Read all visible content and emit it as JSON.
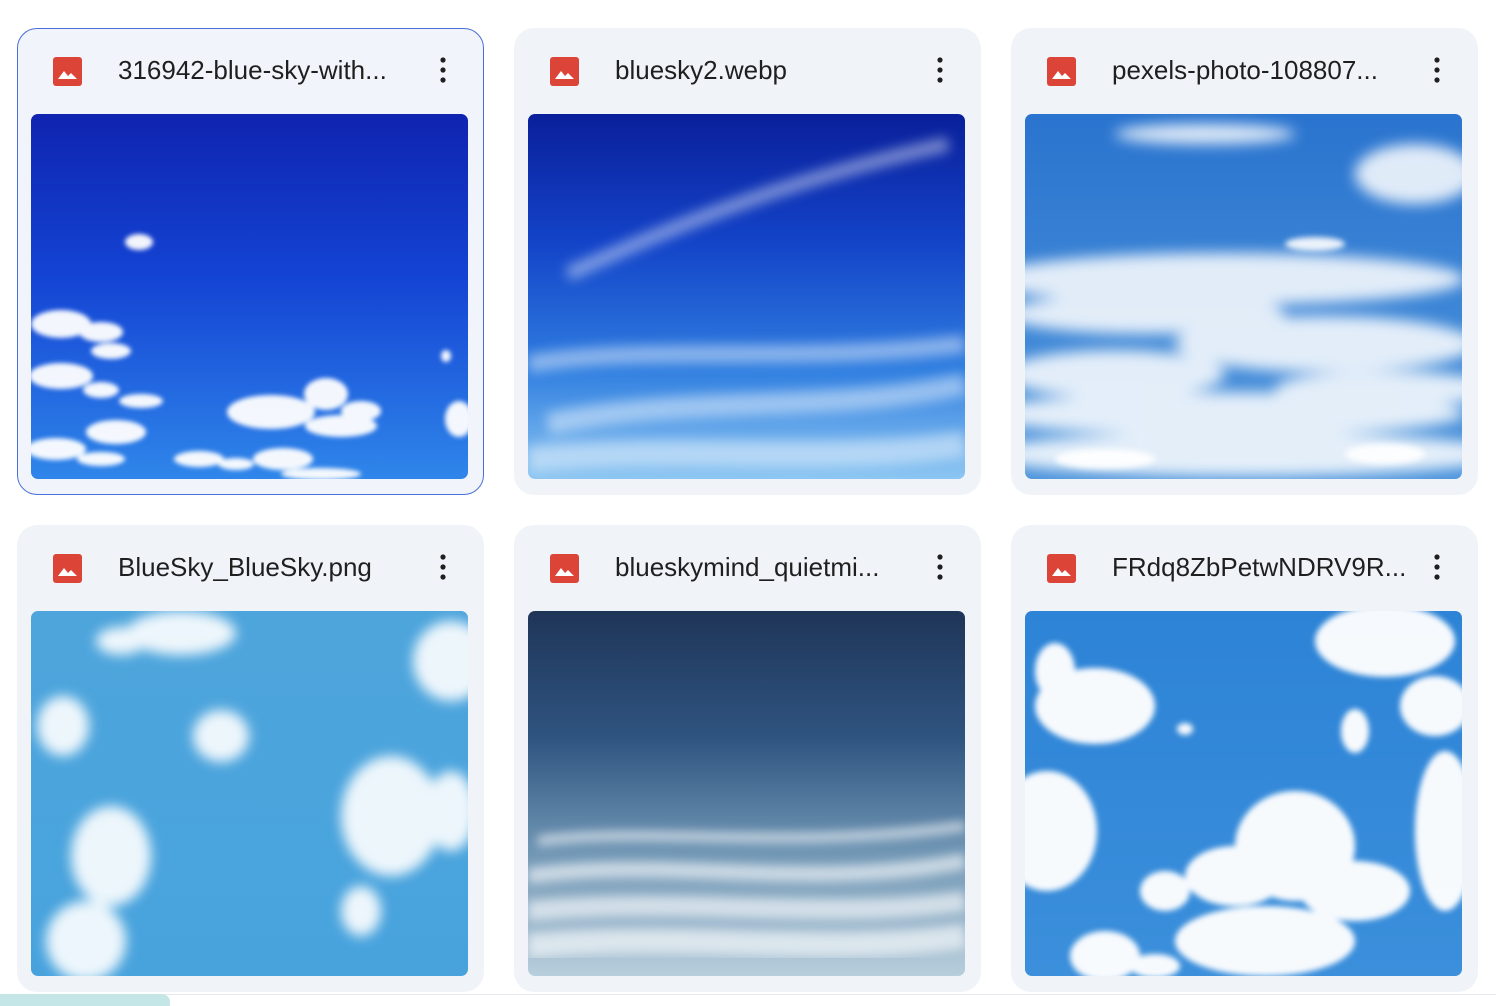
{
  "files": [
    {
      "name": "316942-blue-sky-with...",
      "icon": "image-file-icon",
      "selected": true
    },
    {
      "name": "bluesky2.webp",
      "icon": "image-file-icon",
      "selected": false
    },
    {
      "name": "pexels-photo-108807...",
      "icon": "image-file-icon",
      "selected": false
    },
    {
      "name": "BlueSky_BlueSky.png",
      "icon": "image-file-icon",
      "selected": false
    },
    {
      "name": "blueskymind_quietmi...",
      "icon": "image-file-icon",
      "selected": false
    },
    {
      "name": "FRdq8ZbPetwNDRV9R...",
      "icon": "image-file-icon",
      "selected": false
    }
  ],
  "colors": {
    "file_icon_red": "#db4437",
    "card_background": "#f0f4f9",
    "selected_border": "#4a6fd8",
    "text": "#1f1f1f"
  }
}
